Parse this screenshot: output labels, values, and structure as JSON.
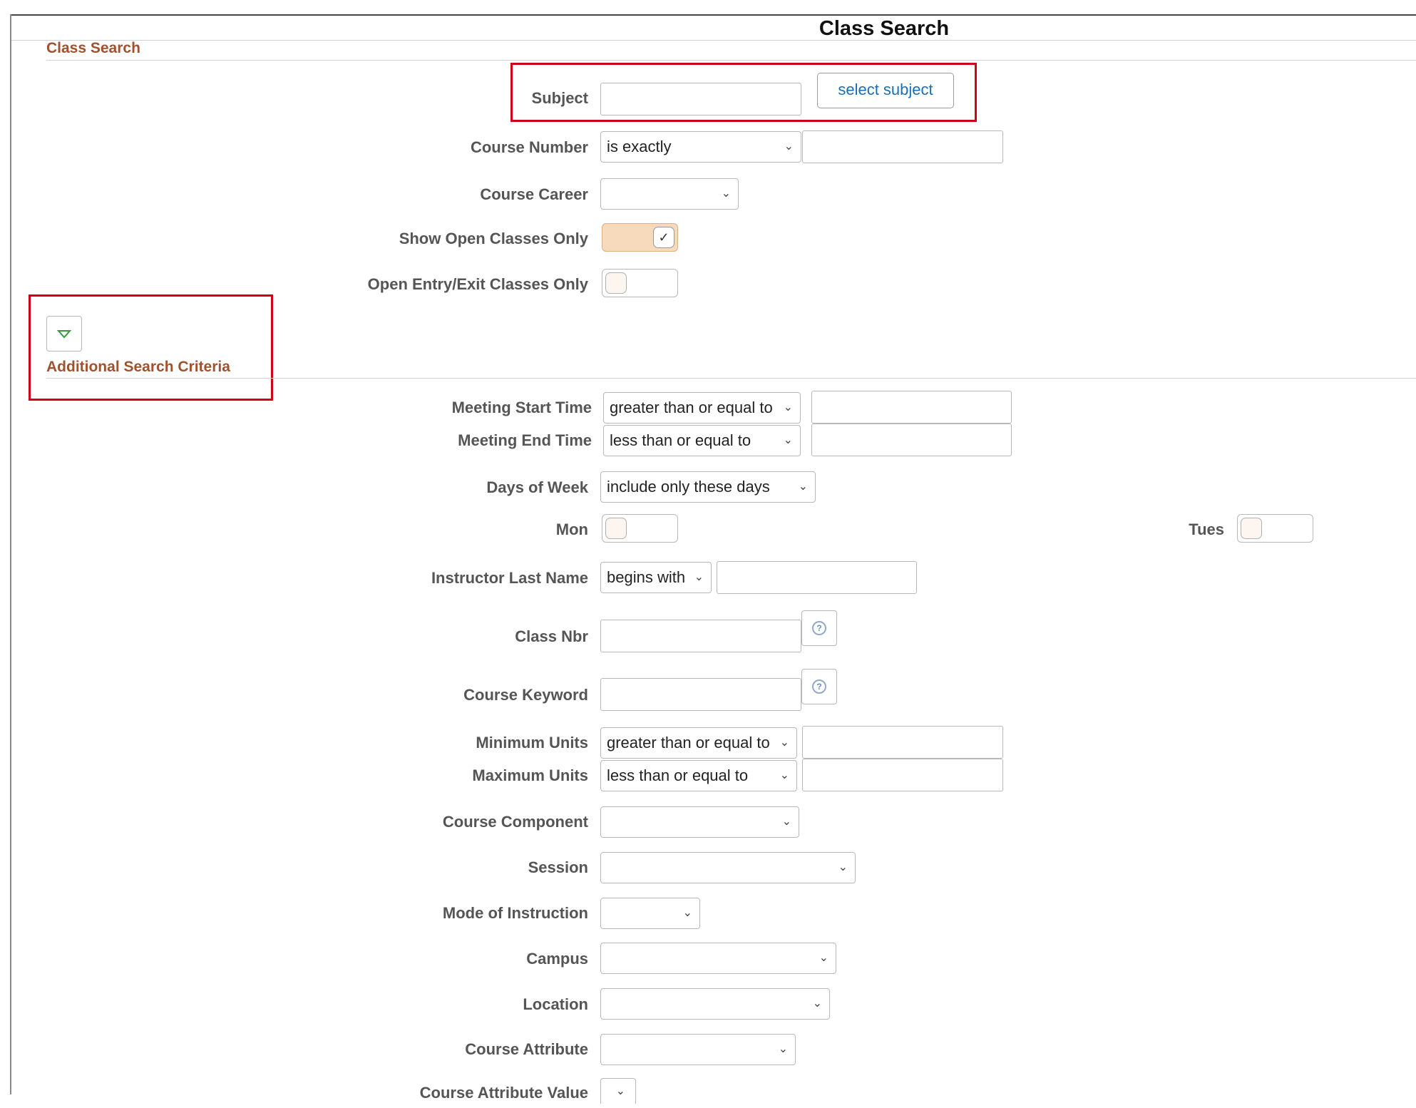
{
  "page_title": "Class Search",
  "section_class_search": "Class Search",
  "section_additional": "Additional Search Criteria",
  "subject": {
    "label": "Subject",
    "value": "",
    "button": "select subject"
  },
  "course_number": {
    "label": "Course Number",
    "operator": "is exactly",
    "value": ""
  },
  "course_career": {
    "label": "Course Career",
    "value": ""
  },
  "show_open_classes": {
    "label": "Show Open Classes Only",
    "checked": true,
    "check_glyph": "✓"
  },
  "open_entry_exit": {
    "label": "Open Entry/Exit Classes Only",
    "checked": false
  },
  "meeting_start": {
    "label": "Meeting Start Time",
    "operator": "greater than or equal to",
    "value": ""
  },
  "meeting_end": {
    "label": "Meeting End Time",
    "operator": "less than or equal to",
    "value": ""
  },
  "days_of_week": {
    "label": "Days of Week",
    "operator": "include only these days"
  },
  "mon": {
    "label": "Mon",
    "checked": false
  },
  "tues": {
    "label": "Tues",
    "checked": false
  },
  "instructor": {
    "label": "Instructor Last Name",
    "operator": "begins with",
    "value": ""
  },
  "class_nbr": {
    "label": "Class Nbr",
    "value": "",
    "help_glyph": "?"
  },
  "course_keyword": {
    "label": "Course Keyword",
    "value": "",
    "help_glyph": "?"
  },
  "min_units": {
    "label": "Minimum Units",
    "operator": "greater than or equal to",
    "value": ""
  },
  "max_units": {
    "label": "Maximum Units",
    "operator": "less than or equal to",
    "value": ""
  },
  "course_component": {
    "label": "Course Component",
    "value": ""
  },
  "session": {
    "label": "Session",
    "value": ""
  },
  "mode_of_instruction": {
    "label": "Mode of Instruction",
    "value": ""
  },
  "campus": {
    "label": "Campus",
    "value": ""
  },
  "location": {
    "label": "Location",
    "value": ""
  },
  "course_attribute": {
    "label": "Course Attribute",
    "value": ""
  },
  "course_attribute_value": {
    "label": "Course Attribute Value",
    "value": ""
  },
  "icons": {
    "chevron": "⌄",
    "expand": "triangle-down-icon"
  },
  "colors": {
    "section_title": "#a0522d",
    "highlight_box": "#d0021b",
    "link": "#1a6eb5",
    "toggle_on": "#f7d9bb"
  }
}
